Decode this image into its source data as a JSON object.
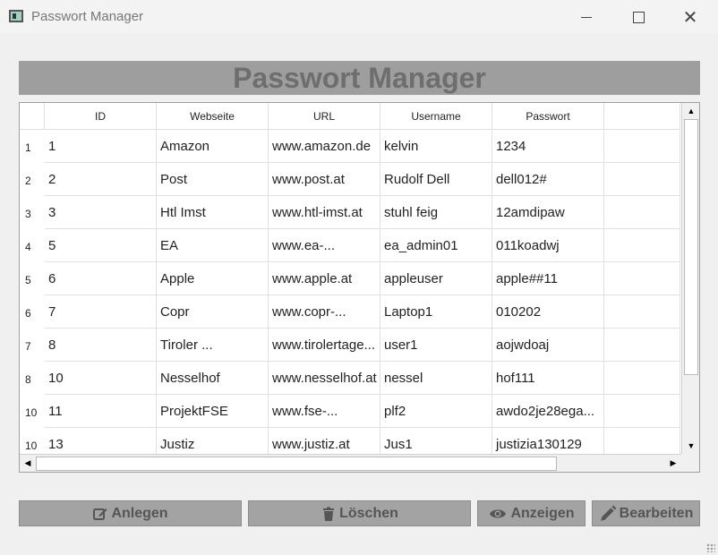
{
  "window": {
    "title": "Passwort Manager",
    "minimize_icon": "minimize-icon",
    "maximize_icon": "maximize-icon",
    "close_icon": "close-icon",
    "close_glyph": "✕"
  },
  "banner": {
    "title": "Passwort Manager"
  },
  "table": {
    "columns": [
      "ID",
      "Webseite",
      "URL",
      "Username",
      "Passwort",
      ""
    ],
    "rows": [
      {
        "num": "1",
        "cells": [
          "1",
          "Amazon",
          "www.amazon.de",
          "kelvin",
          "1234",
          ""
        ]
      },
      {
        "num": "2",
        "cells": [
          "2",
          "Post",
          "www.post.at",
          "Rudolf Dell",
          "dell012#",
          ""
        ]
      },
      {
        "num": "3",
        "cells": [
          "3",
          "Htl Imst",
          "www.htl-imst.at",
          "stuhl feig",
          "12amdipaw",
          ""
        ]
      },
      {
        "num": "4",
        "cells": [
          "5",
          "EA",
          "www.ea-...",
          "ea_admin01",
          "011koadwj",
          ""
        ]
      },
      {
        "num": "5",
        "cells": [
          "6",
          "Apple",
          "www.apple.at",
          "appleuser",
          "apple##11",
          ""
        ]
      },
      {
        "num": "6",
        "cells": [
          "7",
          "Copr",
          "www.copr-...",
          "Laptop1",
          "010202",
          ""
        ]
      },
      {
        "num": "7",
        "cells": [
          "8",
          "Tiroler ...",
          "www.tirolertage...",
          "user1",
          "aojwdoaj",
          ""
        ]
      },
      {
        "num": "8",
        "cells": [
          "10",
          "Nesselhof",
          "www.nesselhof.at",
          "nessel",
          "hof111",
          ""
        ]
      },
      {
        "num": "10",
        "cells": [
          "11",
          "ProjektFSE",
          "www.fse-...",
          "plf2",
          "awdo2je28ega...",
          ""
        ]
      },
      {
        "num": "10",
        "cells": [
          "13",
          "Justiz",
          "www.justiz.at",
          "Jus1",
          "justizia130129",
          ""
        ]
      }
    ],
    "scroll_up_glyph": "▲",
    "scroll_down_glyph": "▼",
    "scroll_left_glyph": "◀",
    "scroll_right_glyph": "▶"
  },
  "buttons": {
    "create": {
      "label": "Anlegen",
      "icon": "edit-icon"
    },
    "delete": {
      "label": "Löschen",
      "icon": "trash-icon"
    },
    "show": {
      "label": "Anzeigen",
      "icon": "eye-icon"
    },
    "edit": {
      "label": "Bearbeiten",
      "icon": "pencil-icon"
    }
  },
  "colors": {
    "banner_bg": "#9e9e9e",
    "banner_text": "#6e6e6e",
    "button_bg": "#a3a3a3",
    "button_text": "#555555"
  }
}
